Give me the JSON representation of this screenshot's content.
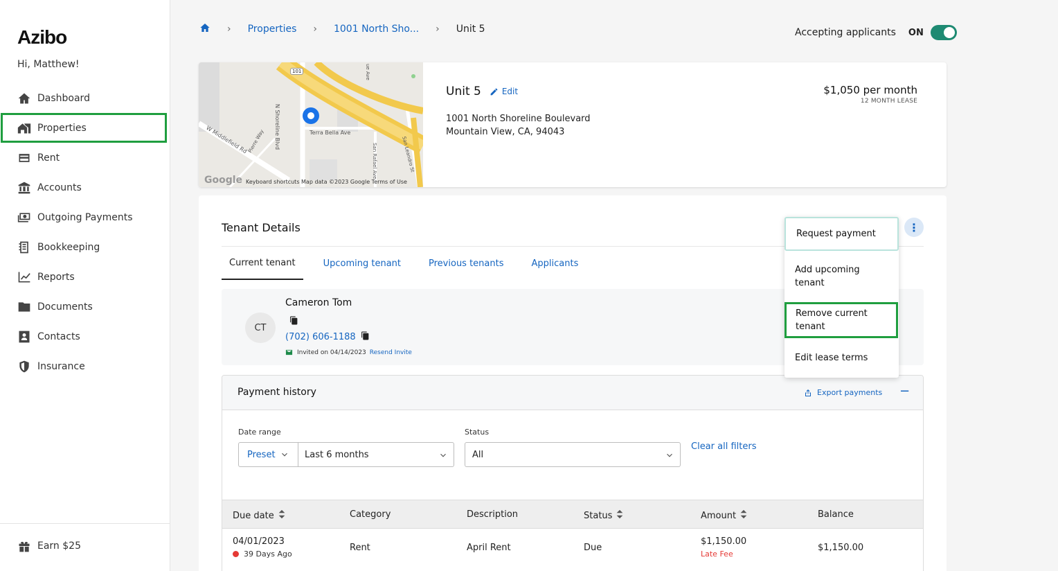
{
  "app": {
    "logo": "Azibo",
    "greeting": "Hi, Matthew!"
  },
  "sidebar": {
    "items": [
      {
        "label": "Dashboard",
        "icon": "home-icon"
      },
      {
        "label": "Properties",
        "icon": "building-icon"
      },
      {
        "label": "Rent",
        "icon": "wallet-icon"
      },
      {
        "label": "Accounts",
        "icon": "bank-icon"
      },
      {
        "label": "Outgoing Payments",
        "icon": "cash-icon"
      },
      {
        "label": "Bookkeeping",
        "icon": "ledger-icon"
      },
      {
        "label": "Reports",
        "icon": "chart-icon"
      },
      {
        "label": "Documents",
        "icon": "folder-icon"
      },
      {
        "label": "Contacts",
        "icon": "contact-card-icon"
      },
      {
        "label": "Insurance",
        "icon": "shield-icon"
      }
    ],
    "bottom": {
      "label": "Earn $25",
      "icon": "gift-icon"
    }
  },
  "breadcrumb": {
    "properties": "Properties",
    "property": "1001 North Sho...",
    "unit": "Unit 5"
  },
  "accepting": {
    "label": "Accepting applicants",
    "state": "ON"
  },
  "unit": {
    "title": "Unit 5",
    "edit": "Edit",
    "address_line1": "1001 North Shoreline Boulevard",
    "address_line2": "Mountain View, CA, 94043",
    "price": "$1,050 per month",
    "lease": "12 MONTH LEASE"
  },
  "map": {
    "labels": {
      "highway": "101",
      "shoreline": "N Shoreline Blvd",
      "terra_bella": "Terra Bella Ave",
      "middlefield": "W Middlefield Rd",
      "rafael": "San Rafael Ave",
      "leandro": "San Leandro St",
      "ave": "ue Ave",
      "way": "Pierre Way"
    },
    "google": "Google",
    "attribution": "Keyboard shortcuts    Map data ©2023 Google    Terms of Use"
  },
  "tenant_details": {
    "title": "Tenant Details",
    "tabs": [
      "Current tenant",
      "Upcoming tenant",
      "Previous tenants",
      "Applicants"
    ],
    "tenant": {
      "initials": "CT",
      "name": "Cameron Tom",
      "phone": "(702) 606-1188",
      "invited": "Invited on 04/14/2023",
      "resend": "Resend Invite"
    }
  },
  "menu": {
    "items": [
      "Request payment",
      "Add upcoming tenant",
      "Remove current tenant",
      "Edit lease terms"
    ]
  },
  "payments": {
    "title": "Payment history",
    "export": "Export payments",
    "date_range_label": "Date range",
    "preset": "Preset",
    "range_value": "Last 6 months",
    "status_label": "Status",
    "status_value": "All",
    "clear": "Clear all filters",
    "columns": [
      "Due date",
      "Category",
      "Description",
      "Status",
      "Amount",
      "Balance"
    ],
    "rows": [
      {
        "due": "04/01/2023",
        "due_note": "39 Days Ago",
        "category": "Rent",
        "description": "April Rent",
        "status": "Due",
        "amount": "$1,150.00",
        "amount_note": "Late Fee",
        "balance": "$1,150.00"
      }
    ]
  },
  "colors": {
    "accent": "#1565c0",
    "highlight": "#1f9e3f",
    "toggle": "#1e8a72"
  }
}
